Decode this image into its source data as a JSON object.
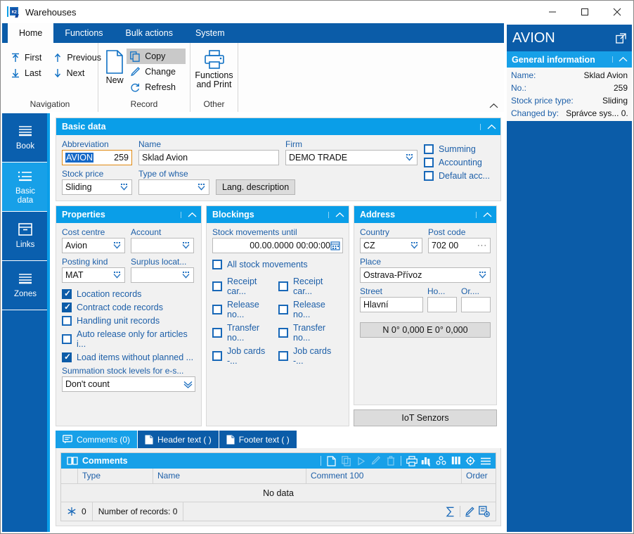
{
  "window": {
    "title": "Warehouses",
    "app_icon": "k2-app-icon",
    "minimize": "—",
    "maximize": "▢",
    "close": "✕"
  },
  "ribbon": {
    "tabs": [
      {
        "label": "Home",
        "active": true
      },
      {
        "label": "Functions",
        "active": false
      },
      {
        "label": "Bulk actions",
        "active": false
      },
      {
        "label": "System",
        "active": false
      }
    ],
    "groups": [
      {
        "label": "Navigation",
        "nav_items": [
          {
            "label": "First",
            "icon": "first-arrow-icon"
          },
          {
            "label": "Previous",
            "icon": "up-arrow-icon"
          },
          {
            "label": "Last",
            "icon": "last-arrow-icon"
          },
          {
            "label": "Next",
            "icon": "down-arrow-icon"
          }
        ]
      },
      {
        "label": "Record",
        "new_label": "New",
        "new_icon": "new-document-icon",
        "small": [
          {
            "label": "Copy",
            "icon": "copy-icon",
            "highlighted": true
          },
          {
            "label": "Change",
            "icon": "pencil-icon",
            "highlighted": false
          },
          {
            "label": "Refresh",
            "icon": "refresh-icon",
            "highlighted": false
          }
        ]
      },
      {
        "label": "Other",
        "print_label_line1": "Functions",
        "print_label_line2": "and Print",
        "print_icon": "printer-icon"
      }
    ],
    "collapse_icon": "chevron-up-icon"
  },
  "rail": {
    "items": [
      {
        "label": "Book",
        "icon": "book-lines-icon",
        "active": false
      },
      {
        "label": "Basic\ndata",
        "label_line1": "Basic",
        "label_line2": "data",
        "icon": "list-icon",
        "active": true
      },
      {
        "label": "Links",
        "icon": "box-icon",
        "active": false
      },
      {
        "label": "Zones",
        "icon": "zones-lines-icon",
        "active": false
      }
    ]
  },
  "basic_data": {
    "title": "Basic data",
    "abbreviation_label": "Abbreviation",
    "abbreviation_value": "AVION",
    "abbreviation_number": "259",
    "name_label": "Name",
    "name_value": "Sklad Avion",
    "firm_label": "Firm",
    "firm_value": "DEMO TRADE",
    "stock_price_label": "Stock price",
    "stock_price_value": "Sliding",
    "type_of_whse_label": "Type of whse",
    "type_of_whse_value": "",
    "lang_description_button": "Lang. description",
    "checkboxes": [
      {
        "label": "Summing",
        "checked": false
      },
      {
        "label": "Accounting",
        "checked": false
      },
      {
        "label": "Default acc...",
        "checked": false
      }
    ]
  },
  "properties": {
    "title": "Properties",
    "cost_centre_label": "Cost centre",
    "cost_centre_value": "Avion",
    "account_label": "Account",
    "account_value": "",
    "posting_kind_label": "Posting kind",
    "posting_kind_value": "MAT",
    "surplus_label": "Surplus locat...",
    "surplus_value": "",
    "checkboxes": [
      {
        "label": "Location records",
        "checked": true
      },
      {
        "label": "Contract code records",
        "checked": true
      },
      {
        "label": "Handling unit records",
        "checked": false
      },
      {
        "label": "Auto release only for articles i...",
        "checked": false
      },
      {
        "label": "Load items without planned ...",
        "checked": true
      }
    ],
    "summation_label": "Summation stock levels for e-s...",
    "summation_value": "Don't count"
  },
  "blockings": {
    "title": "Blockings",
    "stock_movements_label": "Stock movements until",
    "stock_movements_value": "00.00.0000 00:00:00",
    "calendar_icon": "calendar-icon",
    "all_label": "All stock movements",
    "all_checked": false,
    "rows": [
      {
        "left": "Receipt car...",
        "left_checked": false,
        "right": "Receipt car...",
        "right_checked": false
      },
      {
        "left": "Release no...",
        "left_checked": false,
        "right": "Release no...",
        "right_checked": false
      },
      {
        "left": "Transfer no...",
        "left_checked": false,
        "right": "Transfer no...",
        "right_checked": false
      },
      {
        "left": "Job cards -...",
        "left_checked": false,
        "right": "Job cards -...",
        "right_checked": false
      }
    ]
  },
  "address": {
    "title": "Address",
    "country_label": "Country",
    "country_value": "CZ",
    "post_code_label": "Post code",
    "post_code_value": "702 00",
    "post_code_more": "···",
    "place_label": "Place",
    "place_value": "Ostrava-Přívoz",
    "street_label": "Street",
    "street_value": "Hlavní",
    "house_label": "Ho...",
    "house_value": "",
    "orient_label": "Or....",
    "orient_value": "",
    "gps_button": "N 0° 0,000 E 0° 0,000",
    "iot_button": "IoT Senzors"
  },
  "bottom_tabs": [
    {
      "label": "Comments (0)",
      "icon": "comment-icon",
      "active": true
    },
    {
      "label": "Header text ( )",
      "icon": "document-icon",
      "active": false
    },
    {
      "label": "Footer text ( )",
      "icon": "document-icon",
      "active": false
    }
  ],
  "comments_grid": {
    "title": "Comments",
    "title_icon": "book-open-icon",
    "toolbar_icons": [
      {
        "name": "new-record-icon",
        "glyph": "🗋",
        "dim": false
      },
      {
        "name": "copy-record-icon",
        "glyph": "⧉",
        "dim": true
      },
      {
        "name": "run-icon",
        "glyph": "▷",
        "dim": true
      },
      {
        "name": "edit-pencil-icon",
        "glyph": "✎",
        "dim": true
      },
      {
        "name": "delete-trash-icon",
        "glyph": "🗑",
        "dim": true
      },
      {
        "name": "print-icon",
        "glyph": "printer",
        "dim": false
      },
      {
        "name": "chart-bar-icon",
        "glyph": "chart",
        "dim": false
      },
      {
        "name": "pivot-icon",
        "glyph": "pivot",
        "dim": false
      },
      {
        "name": "columns-icon",
        "glyph": "columns",
        "dim": false
      },
      {
        "name": "settings-gear-icon",
        "glyph": "gear",
        "dim": false
      },
      {
        "name": "menu-hamburger-icon",
        "glyph": "menu",
        "dim": false
      }
    ],
    "columns": [
      "",
      "Type",
      "Name",
      "Comment 100",
      "Order"
    ],
    "empty_text": "No data",
    "footer": {
      "filter_icon": "snowflake-icon",
      "filter_count": "0",
      "records_text": "Number of records: 0",
      "sum_icon": "sigma-icon",
      "edit_icon": "pencil-icon",
      "add_icon": "add-record-icon"
    }
  },
  "sidebar": {
    "title": "AVION",
    "external_icon": "external-link-icon",
    "section_title": "General information",
    "rows": [
      {
        "key": "Name:",
        "value": "Sklad Avion"
      },
      {
        "key": "No.:",
        "value": "259"
      },
      {
        "key": "Stock price type:",
        "value": "Sliding"
      },
      {
        "key": "Changed by:",
        "value": "Správce sys... 0."
      }
    ]
  },
  "colors": {
    "ribbon_blue": "#0b5ca8",
    "accent_cyan": "#17a0e8",
    "panel_header": "#0a9ee8",
    "label_blue": "#1d5fa8",
    "focus_orange": "#e08a12",
    "selection_blue": "#1669c8"
  }
}
